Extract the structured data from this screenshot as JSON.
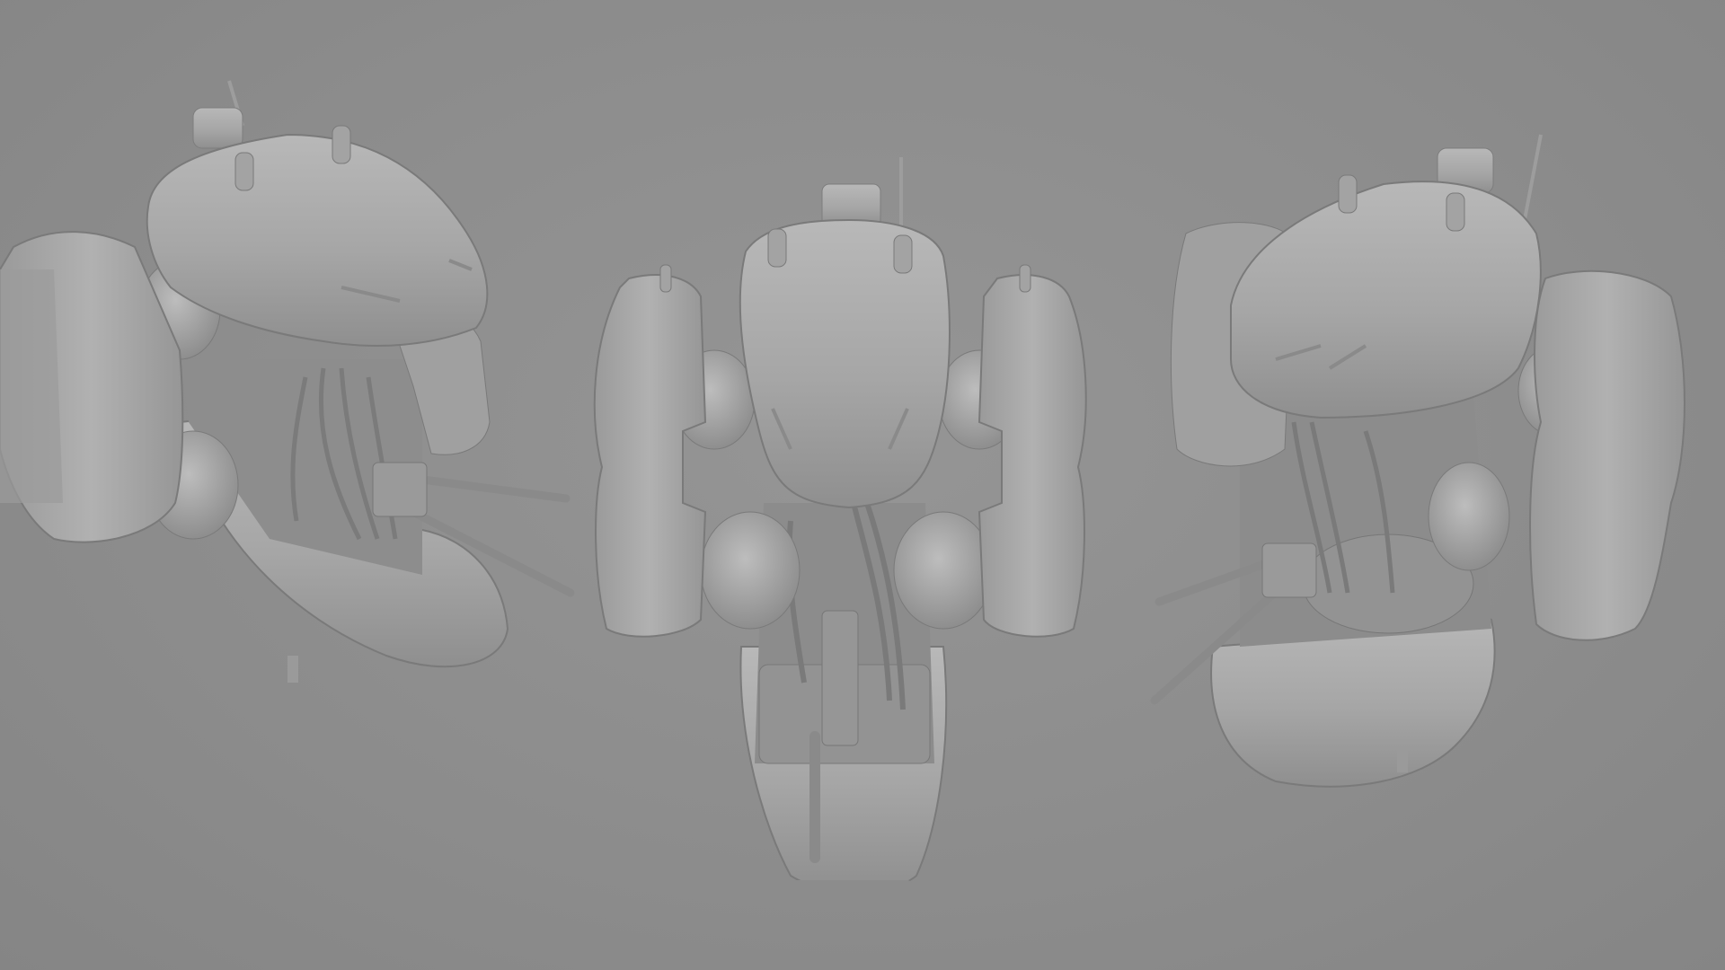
{
  "scene": {
    "background_color": "#8e8e8e",
    "model_color": "#a9a9a9",
    "views": [
      {
        "id": "left",
        "description_icon": "drone-three-quarter-left"
      },
      {
        "id": "front",
        "description_icon": "drone-front"
      },
      {
        "id": "right",
        "description_icon": "drone-three-quarter-right"
      }
    ]
  }
}
